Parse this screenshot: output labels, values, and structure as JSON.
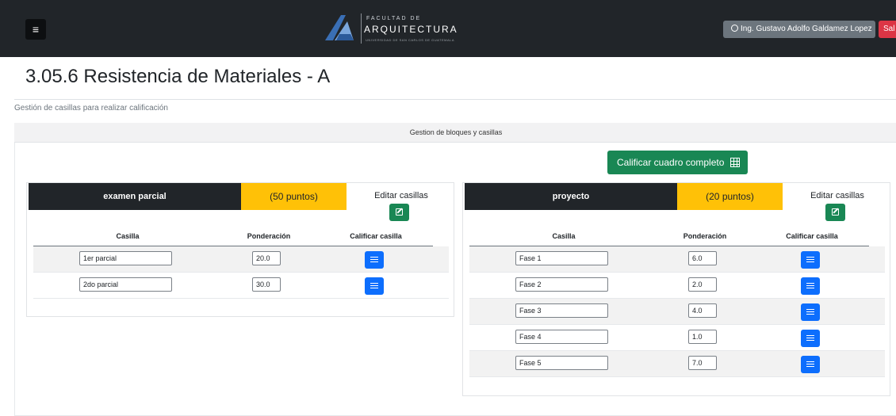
{
  "header": {
    "menu_icon": "hamburger-icon",
    "logo": {
      "line1": "FACULTAD DE",
      "line2": "ARQUITECTURA",
      "line3": "UNIVERSIDAD DE SAN CARLOS DE GUATEMALA"
    },
    "user_label": "Ing. Gustavo Adolfo Galdamez Lopez",
    "user_icon": "user-circle-icon",
    "exit_label": "Sal"
  },
  "page": {
    "title": "3.05.6 Resistencia de Materiales - A",
    "subtitle": "Gestión de casillas para realizar calificación"
  },
  "panel": {
    "header": "Gestion de bloques y casillas",
    "grade_all_label": "Calificar cuadro completo",
    "grade_all_icon": "table-grid-icon"
  },
  "columns": {
    "casilla": "Casilla",
    "ponderacion": "Ponderación",
    "calificar": "Calificar casilla"
  },
  "blocks": [
    {
      "name": "examen parcial",
      "points": "(50 puntos)",
      "edit_label": "Editar casillas",
      "rows": [
        {
          "casilla": "1er parcial",
          "ponderacion": "20.0"
        },
        {
          "casilla": "2do parcial",
          "ponderacion": "30.0"
        }
      ]
    },
    {
      "name": "proyecto",
      "points": "(20 puntos)",
      "edit_label": "Editar casillas",
      "rows": [
        {
          "casilla": "Fase 1",
          "ponderacion": "6.0"
        },
        {
          "casilla": "Fase 2",
          "ponderacion": "2.0"
        },
        {
          "casilla": "Fase 3",
          "ponderacion": "4.0"
        },
        {
          "casilla": "Fase 4",
          "ponderacion": "1.0"
        },
        {
          "casilla": "Fase 5",
          "ponderacion": "7.0"
        }
      ]
    }
  ],
  "colors": {
    "navbar": "#212529",
    "points_badge": "#ffc107",
    "success": "#198754",
    "primary": "#0d6efd",
    "danger": "#dc3545",
    "secondary": "#6c757d"
  }
}
